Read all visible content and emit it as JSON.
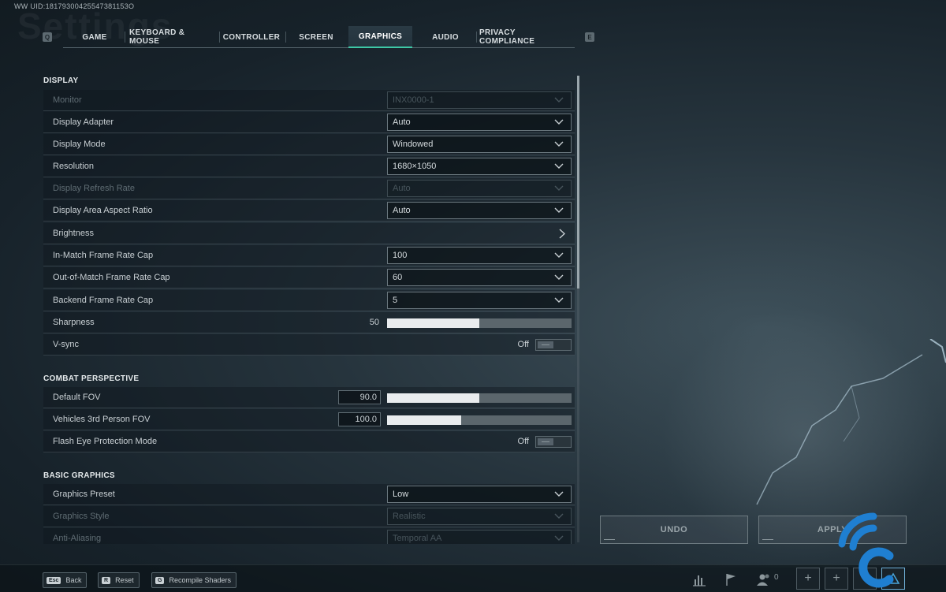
{
  "uid_text": "WW UID:18179300425547381153O",
  "background_title": "Settings",
  "tabs": {
    "left_key": "Q",
    "right_key": "E",
    "items": [
      {
        "label": "GAME"
      },
      {
        "label": "KEYBOARD & MOUSE"
      },
      {
        "label": "CONTROLLER"
      },
      {
        "label": "SCREEN"
      },
      {
        "label": "GRAPHICS",
        "active": true
      },
      {
        "label": "AUDIO"
      },
      {
        "label": "PRIVACY COMPLIANCE"
      }
    ]
  },
  "sections": {
    "display": {
      "title": "DISPLAY",
      "monitor": {
        "label": "Monitor",
        "value": "INX0000-1",
        "disabled": true
      },
      "display_adapter": {
        "label": "Display Adapter",
        "value": "Auto"
      },
      "display_mode": {
        "label": "Display Mode",
        "value": "Windowed"
      },
      "resolution": {
        "label": "Resolution",
        "value": "1680×1050"
      },
      "refresh_rate": {
        "label": "Display Refresh Rate",
        "value": "Auto",
        "disabled": true
      },
      "aspect_ratio": {
        "label": "Display Area Aspect Ratio",
        "value": "Auto"
      },
      "brightness": {
        "label": "Brightness"
      },
      "in_match_cap": {
        "label": "In-Match Frame Rate Cap",
        "value": "100"
      },
      "out_match_cap": {
        "label": "Out-of-Match Frame Rate Cap",
        "value": "60"
      },
      "backend_cap": {
        "label": "Backend Frame Rate Cap",
        "value": "5"
      },
      "sharpness": {
        "label": "Sharpness",
        "value": "50",
        "fill": 0.5
      },
      "vsync": {
        "label": "V-sync",
        "value": "Off"
      }
    },
    "combat": {
      "title": "COMBAT PERSPECTIVE",
      "default_fov": {
        "label": "Default FOV",
        "value": "90.0",
        "fill": 0.5
      },
      "vehicle_fov": {
        "label": "Vehicles 3rd Person FOV",
        "value": "100.0",
        "fill": 0.4
      },
      "flash_eye": {
        "label": "Flash Eye Protection Mode",
        "value": "Off"
      }
    },
    "basic": {
      "title": "BASIC GRAPHICS",
      "preset": {
        "label": "Graphics Preset",
        "value": "Low"
      },
      "style": {
        "label": "Graphics Style",
        "value": "Realistic",
        "disabled": true
      },
      "aa": {
        "label": "Anti-Aliasing",
        "value": "Temporal AA",
        "disabled": true
      }
    }
  },
  "actions": {
    "undo": "UNDO",
    "apply": "APPLY"
  },
  "bottom_hints": [
    {
      "key": "Esc",
      "label": "Back"
    },
    {
      "key": "R",
      "label": "Reset"
    },
    {
      "key": "G",
      "label": "Recompile Shaders"
    }
  ],
  "friends_count": "0",
  "icons": {
    "stats": "bar-chart-icon",
    "flag": "flag-icon",
    "friends": "friends-icon",
    "add": "plus-icon",
    "warning": "triangle-icon"
  },
  "colors": {
    "accent": "#3ec8a6",
    "watermark": "#1f7fd1"
  }
}
